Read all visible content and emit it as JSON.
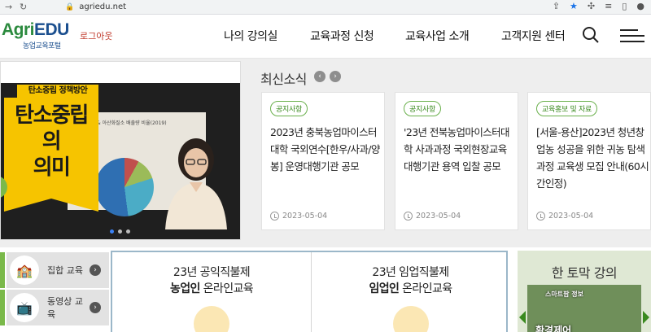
{
  "browser": {
    "url": "agriedu.net"
  },
  "header": {
    "logo_part1": "Agri",
    "logo_part2": "EDU",
    "logo_sub": "농업교육포털",
    "logout": "로그아웃",
    "nav": [
      "나의 강의실",
      "교육과정 신청",
      "교육사업 소개",
      "고객지원 센터"
    ]
  },
  "banner": {
    "tag": "탄소중립 정책방안",
    "headline_line1": "탄소중립의",
    "headline_line2": "의미",
    "slide_caption": "& 아산화질소 배출량 비율(2019)",
    "slide_count": 3,
    "active_slide": 1
  },
  "news": {
    "title": "최신소식",
    "prev": "‹",
    "next": "›",
    "cards": [
      {
        "badge": "공지사항",
        "title": "2023년 충북농업마이스터대학 국외연수[한우/사과/양봉] 운영대행기관 공모",
        "date": "2023-05-04"
      },
      {
        "badge": "공지사항",
        "title": "'23년 전북농업마이스터대학 사과과정 국외현장교육 대행기관 용역 입찰 공모",
        "date": "2023-05-04"
      },
      {
        "badge": "교육홍보 및 자료",
        "title": "[서울-용산]2023년 청년창업농 성공을 위한 귀농 탐색과정 교육생 모집 안내(60시간인정)",
        "date": "2023-05-04"
      }
    ]
  },
  "side_menu": [
    {
      "label": "집합 교육",
      "go": "›"
    },
    {
      "label": "동영상 교육",
      "go": "›"
    }
  ],
  "courses": [
    {
      "line1": "23년 공익직불제",
      "bold": "농업인",
      "rest": " 온라인교육"
    },
    {
      "line1": "23년 임업직불제",
      "bold": "임업인",
      "rest": " 온라인교육"
    }
  ],
  "onecut": {
    "title": "한 토막 강의",
    "thumb_badge": "스마트팜 정보",
    "thumb_caption": "환경제어"
  }
}
